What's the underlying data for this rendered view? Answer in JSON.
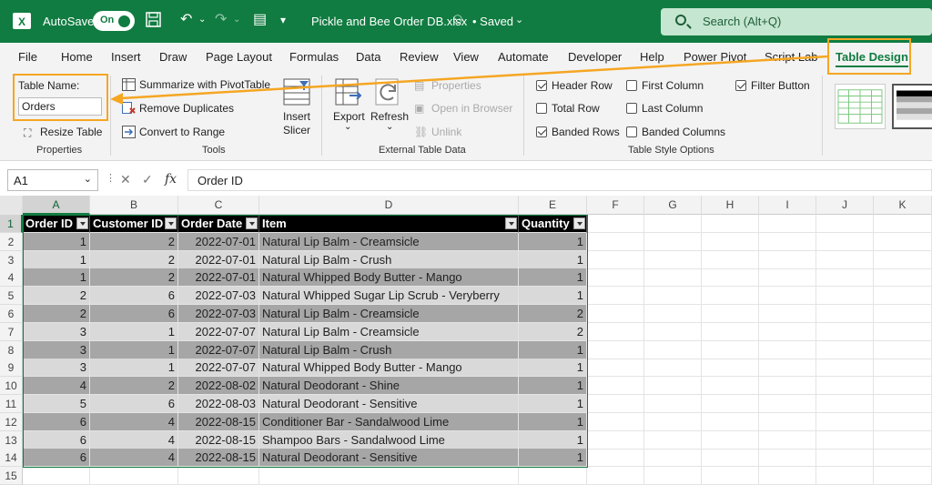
{
  "titlebar": {
    "autosave_label": "AutoSave",
    "toggle_label": "On",
    "filename": "Pickle and Bee Order DB.xlsx",
    "saved_label": "• Saved",
    "search_placeholder": "Search (Alt+Q)"
  },
  "menu": {
    "items": [
      "File",
      "Home",
      "Insert",
      "Draw",
      "Page Layout",
      "Formulas",
      "Data",
      "Review",
      "View",
      "Automate",
      "Developer",
      "Help",
      "Power Pivot",
      "Script Lab",
      "Table Design"
    ],
    "active": "Table Design"
  },
  "ribbon": {
    "properties": {
      "table_name_label": "Table Name:",
      "table_name_value": "Orders",
      "resize_label": "Resize Table",
      "group_label": "Properties"
    },
    "tools": {
      "summarize_label": "Summarize with PivotTable",
      "remove_dup_label": "Remove Duplicates",
      "convert_label": "Convert to Range",
      "insert_slicer_line1": "Insert",
      "insert_slicer_line2": "Slicer",
      "group_label": "Tools"
    },
    "external": {
      "export_label": "Export",
      "refresh_label": "Refresh",
      "properties_label": "Properties",
      "open_browser_label": "Open in Browser",
      "unlink_label": "Unlink",
      "group_label": "External Table Data"
    },
    "style_options": {
      "header_row": "Header Row",
      "total_row": "Total Row",
      "banded_rows": "Banded Rows",
      "first_column": "First Column",
      "last_column": "Last Column",
      "banded_columns": "Banded Columns",
      "filter_button": "Filter Button",
      "group_label": "Table Style Options",
      "checked": {
        "header_row": true,
        "total_row": false,
        "banded_rows": true,
        "first_column": false,
        "last_column": false,
        "banded_columns": false,
        "filter_button": true
      }
    }
  },
  "formula_bar": {
    "name_box": "A1",
    "formula": "Order ID"
  },
  "grid": {
    "columns": [
      "A",
      "B",
      "C",
      "D",
      "E",
      "F",
      "G",
      "H",
      "I",
      "J",
      "K"
    ],
    "rows": [
      "1",
      "2",
      "3",
      "4",
      "5",
      "6",
      "7",
      "8",
      "9",
      "10",
      "11",
      "12",
      "13",
      "14",
      "15"
    ],
    "headers": [
      "Order ID",
      "Customer ID",
      "Order Date",
      "Item",
      "Quantity"
    ],
    "data": [
      [
        "1",
        "2",
        "2022-07-01",
        "Natural Lip Balm - Creamsicle",
        "1"
      ],
      [
        "1",
        "2",
        "2022-07-01",
        "Natural Lip Balm - Crush",
        "1"
      ],
      [
        "1",
        "2",
        "2022-07-01",
        "Natural Whipped Body Butter - Mango",
        "1"
      ],
      [
        "2",
        "6",
        "2022-07-03",
        "Natural Whipped Sugar Lip Scrub - Veryberry",
        "1"
      ],
      [
        "2",
        "6",
        "2022-07-03",
        "Natural Lip Balm - Creamsicle",
        "2"
      ],
      [
        "3",
        "1",
        "2022-07-07",
        "Natural Lip Balm - Creamsicle",
        "2"
      ],
      [
        "3",
        "1",
        "2022-07-07",
        "Natural Lip Balm - Crush",
        "1"
      ],
      [
        "3",
        "1",
        "2022-07-07",
        "Natural Whipped Body Butter - Mango",
        "1"
      ],
      [
        "4",
        "2",
        "2022-08-02",
        "Natural Deodorant - Shine",
        "1"
      ],
      [
        "5",
        "6",
        "2022-08-03",
        "Natural Deodorant - Sensitive",
        "1"
      ],
      [
        "6",
        "4",
        "2022-08-15",
        "Conditioner Bar - Sandalwood Lime",
        "1"
      ],
      [
        "6",
        "4",
        "2022-08-15",
        "Shampoo Bars - Sandalwood Lime",
        "1"
      ],
      [
        "6",
        "4",
        "2022-08-15",
        "Natural Deodorant - Sensitive",
        "1"
      ]
    ]
  },
  "colors": {
    "excel_green": "#107c41",
    "callout": "#f5a623",
    "band_dark": "#a6a6a6",
    "band_light": "#d9d9d9"
  }
}
